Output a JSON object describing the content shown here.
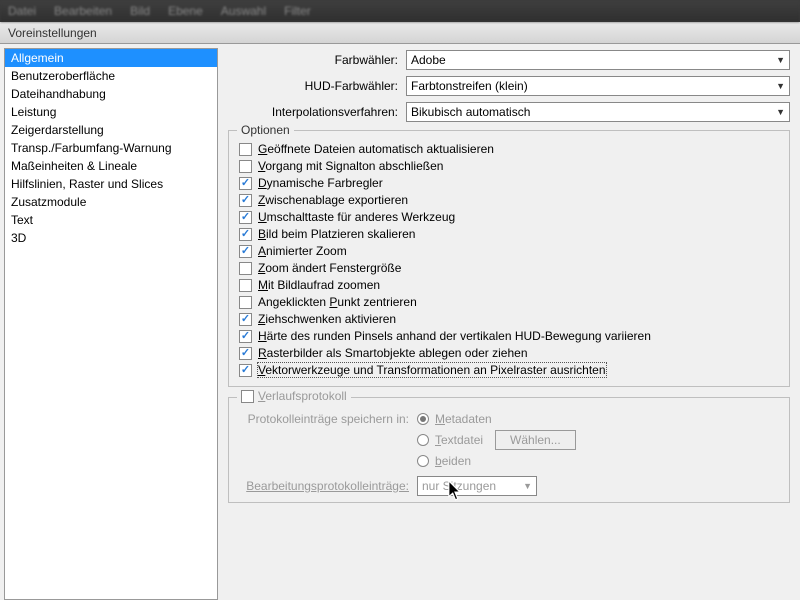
{
  "window": {
    "title": "Voreinstellungen"
  },
  "menubar": [
    "Datei",
    "Bearbeiten",
    "Bild",
    "Ebene",
    "Auswahl",
    "Filter",
    "?"
  ],
  "sidebar": {
    "items": [
      {
        "label": "Allgemein",
        "selected": true
      },
      {
        "label": "Benutzeroberfläche"
      },
      {
        "label": "Dateihandhabung"
      },
      {
        "label": "Leistung"
      },
      {
        "label": "Zeigerdarstellung"
      },
      {
        "label": "Transp./Farbumfang-Warnung"
      },
      {
        "label": "Maßeinheiten & Lineale"
      },
      {
        "label": "Hilfslinien, Raster und Slices"
      },
      {
        "label": "Zusatzmodule"
      },
      {
        "label": "Text"
      },
      {
        "label": "3D"
      }
    ]
  },
  "selects": {
    "colorpicker": {
      "label": "Farbwähler:",
      "value": "Adobe"
    },
    "hud": {
      "label": "HUD-Farbwähler:",
      "value": "Farbtonstreifen (klein)"
    },
    "interp": {
      "label": "Interpolationsverfahren:",
      "value": "Bikubisch automatisch"
    }
  },
  "options": {
    "legend": "Optionen",
    "items": [
      {
        "checked": false,
        "label_pre": "",
        "u": "G",
        "label_post": "eöffnete Dateien automatisch aktualisieren"
      },
      {
        "checked": false,
        "label_pre": "",
        "u": "V",
        "label_post": "organg mit Signalton abschließen"
      },
      {
        "checked": true,
        "label_pre": "",
        "u": "D",
        "label_post": "ynamische Farbregler"
      },
      {
        "checked": true,
        "label_pre": "",
        "u": "Z",
        "label_post": "wischenablage exportieren"
      },
      {
        "checked": true,
        "label_pre": "",
        "u": "U",
        "label_post": "mschalttaste für anderes Werkzeug"
      },
      {
        "checked": true,
        "label_pre": "",
        "u": "B",
        "label_post": "ild beim Platzieren skalieren"
      },
      {
        "checked": true,
        "label_pre": "",
        "u": "A",
        "label_post": "nimierter Zoom"
      },
      {
        "checked": false,
        "label_pre": "",
        "u": "Z",
        "label_post": "oom ändert Fenstergröße"
      },
      {
        "checked": false,
        "label_pre": "",
        "u": "M",
        "label_post": "it Bildlaufrad zoomen"
      },
      {
        "checked": false,
        "label_pre": "Angeklickten ",
        "u": "P",
        "label_post": "unkt zentrieren"
      },
      {
        "checked": true,
        "label_pre": "",
        "u": "Z",
        "label_post": "iehschwenken aktivieren"
      },
      {
        "checked": true,
        "label_pre": "",
        "u": "H",
        "label_post": "ärte des runden Pinsels anhand der vertikalen HUD-Bewegung variieren"
      },
      {
        "checked": true,
        "label_pre": "",
        "u": "R",
        "label_post": "asterbilder als Smartobjekte ablegen oder ziehen"
      },
      {
        "checked": true,
        "label_pre": "",
        "u": "V",
        "label_post": "ektorwerkzeuge und Transformationen an Pixelraster ausrichten",
        "focused": true
      }
    ]
  },
  "history": {
    "legend_u": "V",
    "legend_rest": "erlaufsprotokoll",
    "save_label": "Protokolleinträge speichern in:",
    "radios": [
      {
        "u": "M",
        "rest": "etadaten",
        "checked": true
      },
      {
        "u": "T",
        "rest": "extdatei",
        "checked": false
      },
      {
        "u": "b",
        "rest": "eiden",
        "checked": false
      }
    ],
    "choose": "Wählen...",
    "entries_label": "Bearbeitungsprotokolleinträge:",
    "entries_value": "nur Sitzungen"
  }
}
